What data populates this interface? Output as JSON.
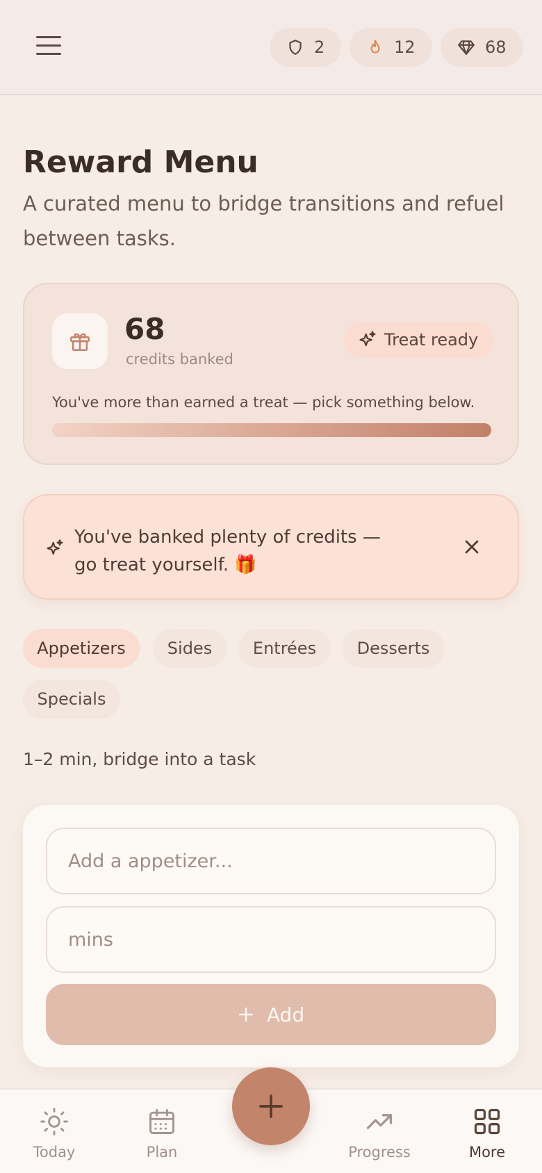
{
  "header": {
    "stats": [
      {
        "icon": "shield-icon",
        "value": "2"
      },
      {
        "icon": "flame-icon",
        "value": "12"
      },
      {
        "icon": "gem-icon",
        "value": "68"
      }
    ]
  },
  "page": {
    "title": "Reward Menu",
    "subtitle": "A curated menu to bridge transitions and refuel between tasks."
  },
  "credits": {
    "amount": "68",
    "label": "credits banked",
    "badge": "Treat ready",
    "message": "You've more than earned a treat — pick something below.",
    "progress_percent": 100
  },
  "alert": {
    "text": "You've banked plenty of credits — go treat yourself. 🎁"
  },
  "tabs": [
    {
      "label": "Appetizers",
      "active": true
    },
    {
      "label": "Sides",
      "active": false
    },
    {
      "label": "Entrées",
      "active": false
    },
    {
      "label": "Desserts",
      "active": false
    },
    {
      "label": "Specials",
      "active": false
    }
  ],
  "section": {
    "description": "1–2 min, bridge into a task"
  },
  "form": {
    "name_placeholder": "Add a appetizer...",
    "mins_placeholder": "mins",
    "add_label": "Add"
  },
  "nav": {
    "items": [
      {
        "label": "Today",
        "icon": "sun-icon"
      },
      {
        "label": "Plan",
        "icon": "calendar-icon"
      },
      {
        "label": "Progress",
        "icon": "trending-up-icon"
      },
      {
        "label": "More",
        "icon": "grid-icon"
      }
    ]
  },
  "colors": {
    "accent": "#c2856b",
    "background": "#f6ede7",
    "active_tab": "#fbdcd0"
  }
}
